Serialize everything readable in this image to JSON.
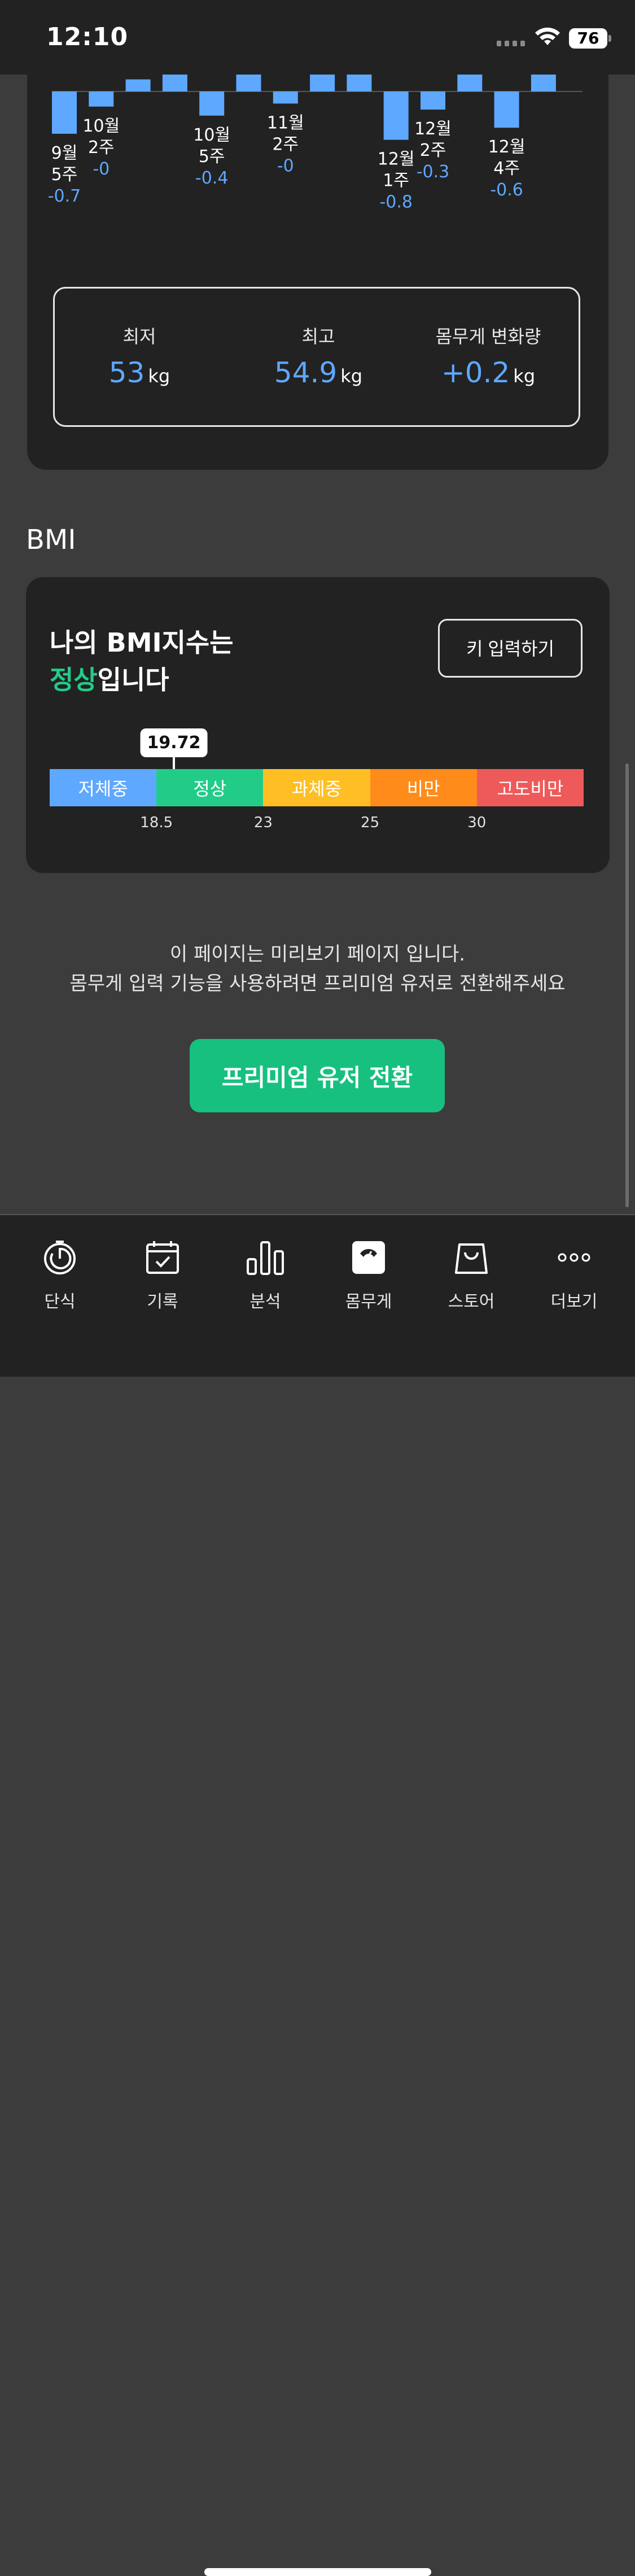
{
  "status_bar": {
    "time": "12:10",
    "battery": "76"
  },
  "chart_data": {
    "type": "bar",
    "title": "",
    "labeled_bars": [
      {
        "label_line1": "9월",
        "label_line2": "5주",
        "value": "-0.7"
      },
      {
        "label_line1": "10월",
        "label_line2": "2주",
        "value": "-0"
      },
      {
        "label_line1": "10월",
        "label_line2": "5주",
        "value": "-0.4"
      },
      {
        "label_line1": "11월",
        "label_line2": "2주",
        "value": "-0"
      },
      {
        "label_line1": "12월",
        "label_line2": "1주",
        "value": "-0.8"
      },
      {
        "label_line1": "12월",
        "label_line2": "2주",
        "value": "-0.3"
      },
      {
        "label_line1": "12월",
        "label_line2": "4주",
        "value": "-0.6"
      }
    ],
    "values": [
      -0.7,
      -0.25,
      0.2,
      0.3,
      -0.4,
      0.3,
      -0.2,
      0.3,
      0.3,
      -0.8,
      -0.3,
      0.3,
      -0.6,
      0.3
    ],
    "baseline": 0
  },
  "stats": {
    "min": {
      "label": "최저",
      "value": "53",
      "unit": "kg"
    },
    "max": {
      "label": "최고",
      "value": "54.9",
      "unit": "kg"
    },
    "change": {
      "label": "몸무게 변화량",
      "value": "+0.2",
      "unit": "kg"
    }
  },
  "bmi": {
    "heading": "BMI",
    "title_line1": "나의 BMI지수는",
    "status": "정상",
    "status_suffix": "입니다",
    "height_button": "키 입력하기",
    "value": "19.72",
    "segments": [
      "저체중",
      "정상",
      "과체중",
      "비만",
      "고도비만"
    ],
    "segment_colors": [
      "#5ea8ff",
      "#22cc88",
      "#ffbf24",
      "#ff8c1a",
      "#ee5a5a"
    ],
    "ticks": [
      "18.5",
      "23",
      "25",
      "30"
    ]
  },
  "notice": {
    "line1": "이 페이지는 미리보기 페이지 입니다.",
    "line2": "몸무게 입력 기능을 사용하려면 프리미엄 유저로 전환해주세요",
    "button": "프리미엄 유저 전환"
  },
  "tabs": [
    {
      "label": "단식",
      "icon": "fasting-timer-icon"
    },
    {
      "label": "기록",
      "icon": "calendar-check-icon"
    },
    {
      "label": "분석",
      "icon": "bar-chart-icon"
    },
    {
      "label": "몸무게",
      "icon": "scale-icon"
    },
    {
      "label": "스토어",
      "icon": "shopping-bag-icon"
    },
    {
      "label": "더보기",
      "icon": "more-dots-icon"
    }
  ]
}
